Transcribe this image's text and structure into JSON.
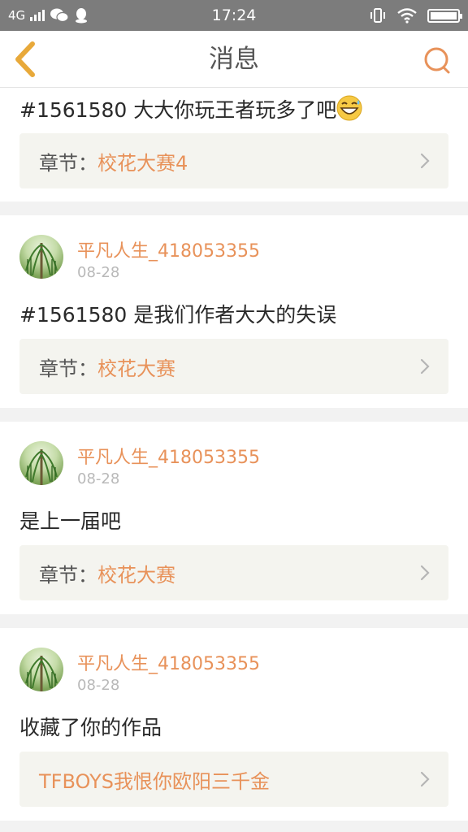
{
  "status_bar": {
    "network": "4G",
    "time": "17:24"
  },
  "header": {
    "title": "消息"
  },
  "messages": [
    {
      "text": "#1561580 大大你玩王者玩多了吧",
      "emoji": "grinning-sweat-emoji",
      "link_prefix": "章节：",
      "link_name": "校花大赛4"
    },
    {
      "user": "平凡人生_418053355",
      "date": "08-28",
      "text": "#1561580 是我们作者大大的失误",
      "link_prefix": "章节：",
      "link_name": "校花大赛"
    },
    {
      "user": "平凡人生_418053355",
      "date": "08-28",
      "text": "是上一届吧",
      "link_prefix": "章节：",
      "link_name": "校花大赛"
    },
    {
      "user": "平凡人生_418053355",
      "date": "08-28",
      "text": "收藏了你的作品",
      "link_prefix": "",
      "link_name": "TFBOYS我恨你欧阳三千金"
    }
  ],
  "colors": {
    "accent": "#e8925a",
    "back_arrow": "#e8a93a",
    "status_bar": "#7c7c7c"
  }
}
